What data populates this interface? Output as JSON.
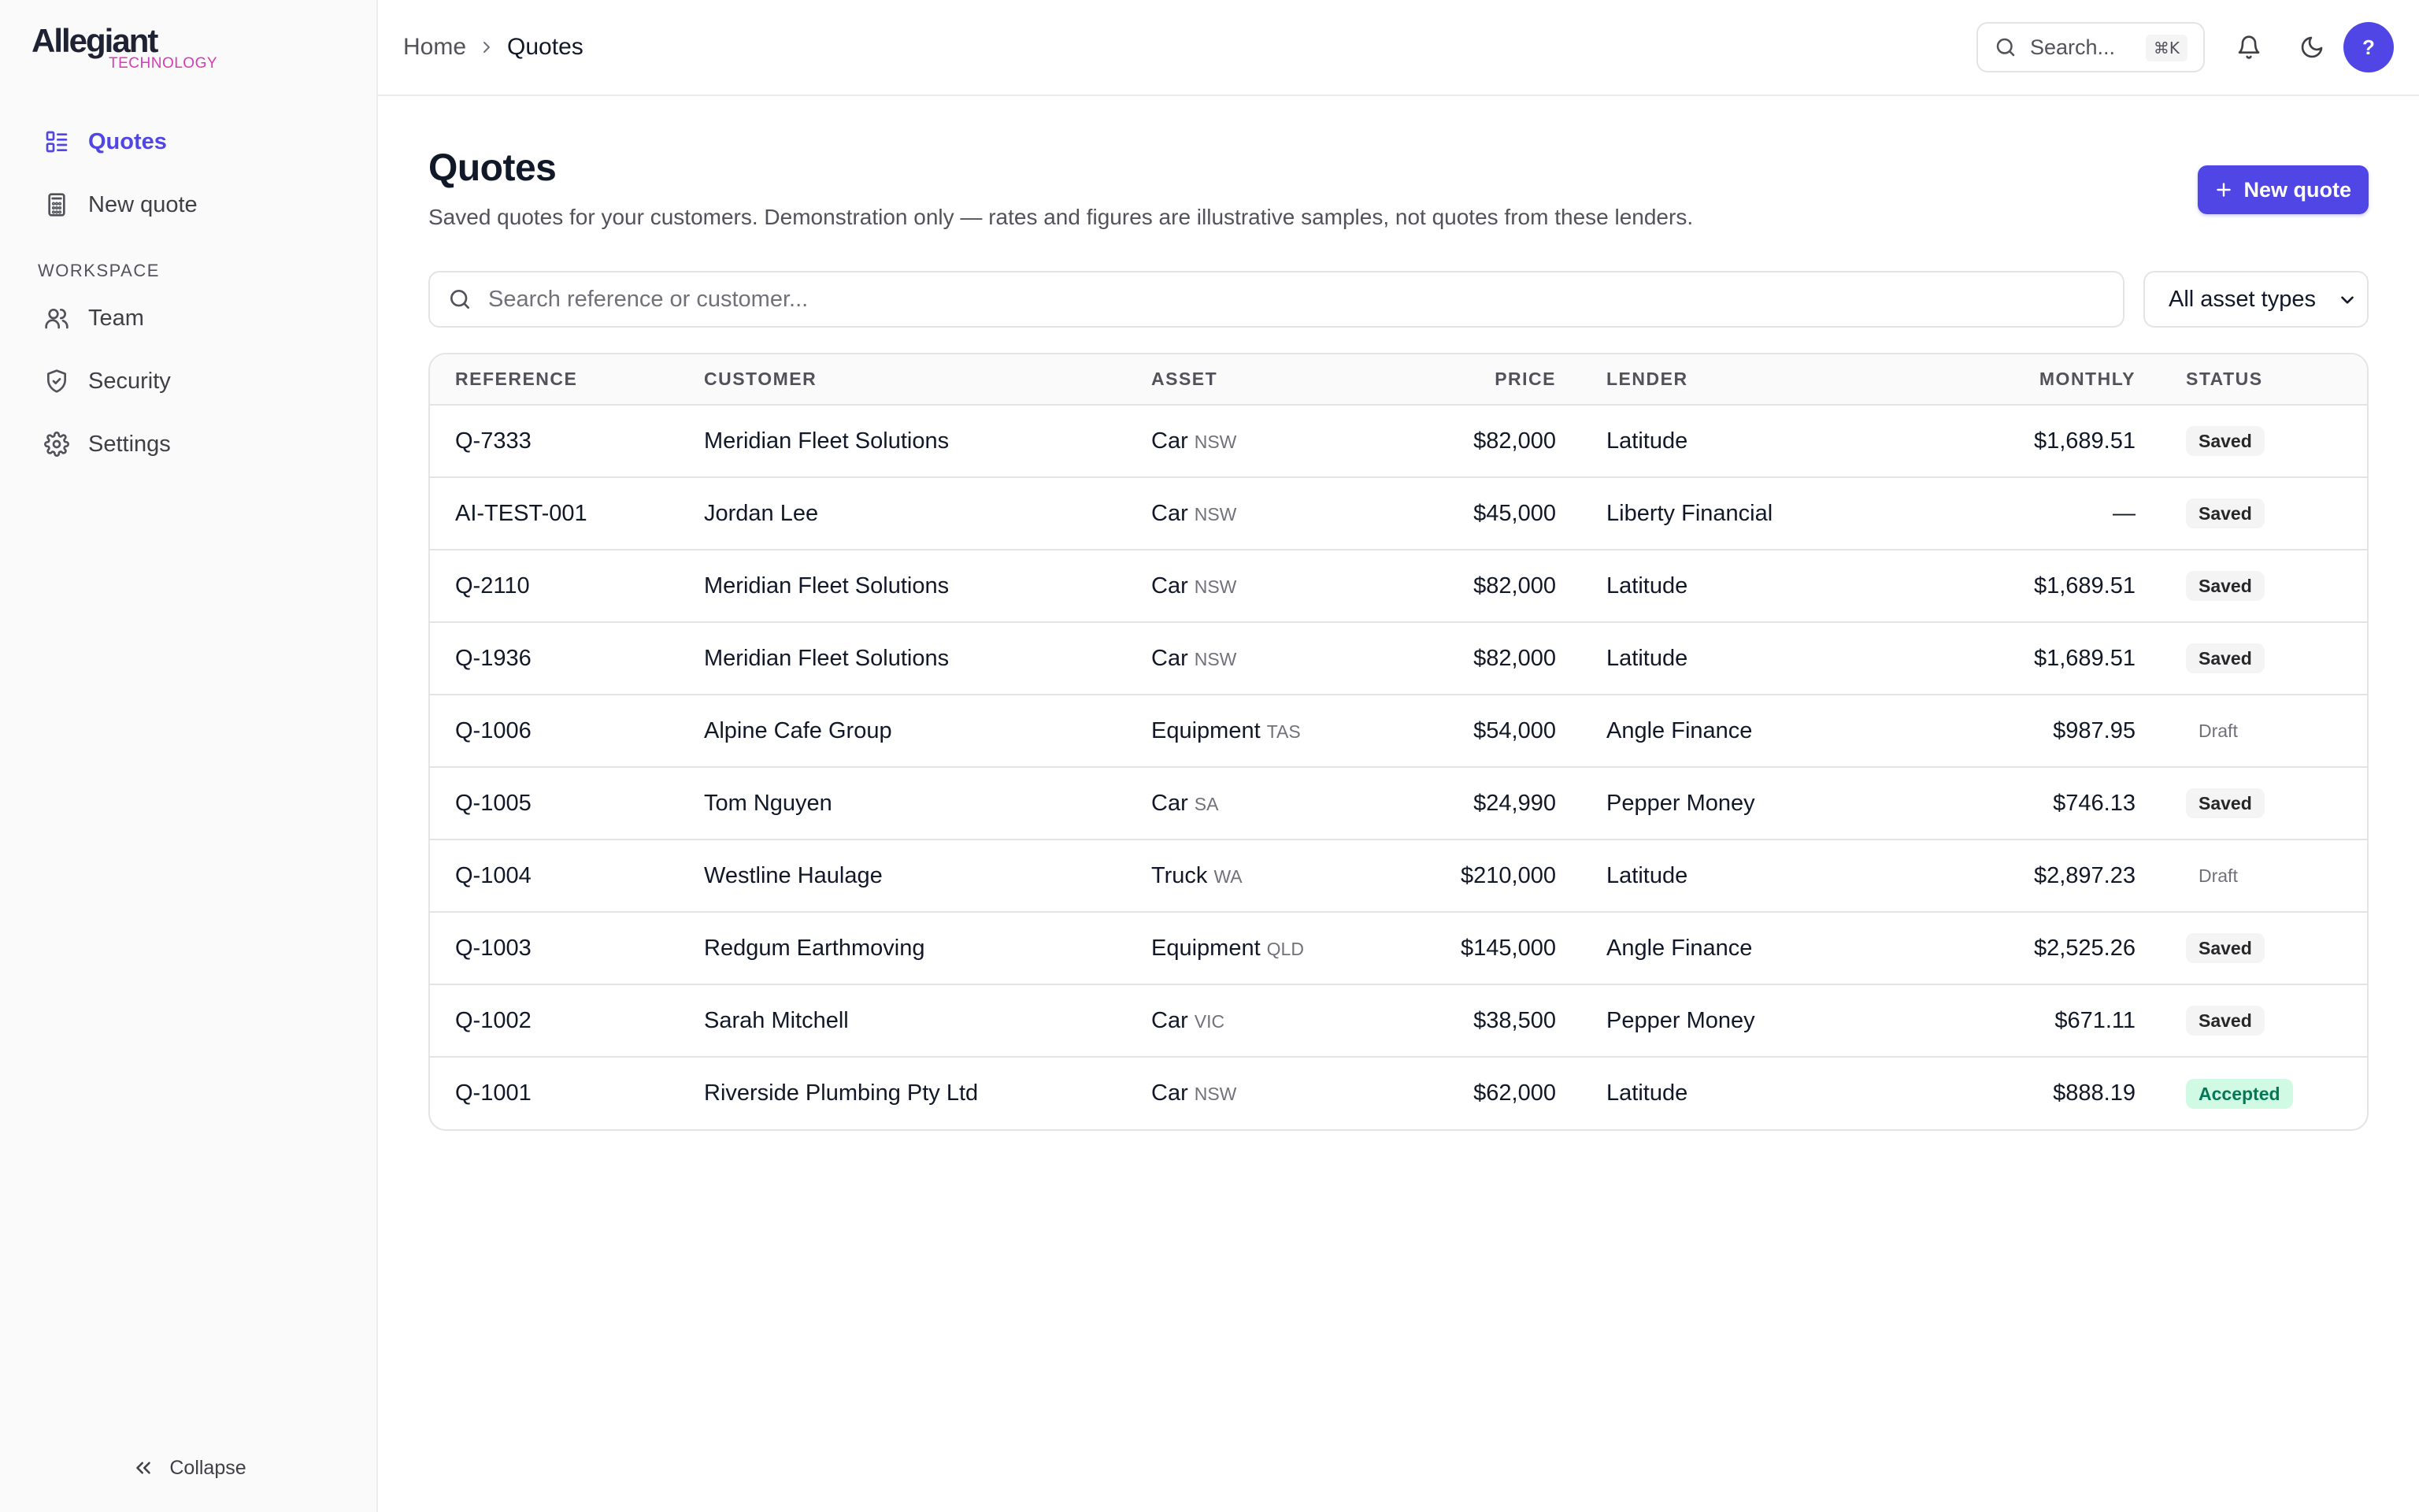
{
  "brand": {
    "name": "Allegiant",
    "sub": "TECHNOLOGY"
  },
  "sidebar": {
    "items": [
      {
        "label": "Quotes",
        "icon": "list-grid-icon",
        "active": true
      },
      {
        "label": "New quote",
        "icon": "calculator-icon"
      }
    ],
    "section_label": "WORKSPACE",
    "workspace_items": [
      {
        "label": "Team",
        "icon": "users-icon"
      },
      {
        "label": "Security",
        "icon": "shield-icon"
      },
      {
        "label": "Settings",
        "icon": "gear-icon"
      }
    ],
    "collapse_label": "Collapse"
  },
  "header": {
    "breadcrumb": {
      "home": "Home",
      "current": "Quotes"
    },
    "search": {
      "placeholder": "Search...",
      "shortcut": "⌘K"
    },
    "avatar_label": "?"
  },
  "page": {
    "title": "Quotes",
    "subtitle": "Saved quotes for your customers. Demonstration only — rates and figures are illustrative samples, not quotes from these lenders.",
    "new_button": "New quote",
    "filter_placeholder": "Search reference or customer...",
    "asset_filter": "All asset types"
  },
  "table": {
    "columns": [
      "REFERENCE",
      "CUSTOMER",
      "ASSET",
      "PRICE",
      "LENDER",
      "MONTHLY",
      "STATUS"
    ],
    "rows": [
      {
        "reference": "Q-7333",
        "customer": "Meridian Fleet Solutions",
        "asset": "Car",
        "state": "NSW",
        "price": "$82,000",
        "lender": "Latitude",
        "monthly": "$1,689.51",
        "status": "Saved"
      },
      {
        "reference": "AI-TEST-001",
        "customer": "Jordan Lee",
        "asset": "Car",
        "state": "NSW",
        "price": "$45,000",
        "lender": "Liberty Financial",
        "monthly": "—",
        "status": "Saved"
      },
      {
        "reference": "Q-2110",
        "customer": "Meridian Fleet Solutions",
        "asset": "Car",
        "state": "NSW",
        "price": "$82,000",
        "lender": "Latitude",
        "monthly": "$1,689.51",
        "status": "Saved"
      },
      {
        "reference": "Q-1936",
        "customer": "Meridian Fleet Solutions",
        "asset": "Car",
        "state": "NSW",
        "price": "$82,000",
        "lender": "Latitude",
        "monthly": "$1,689.51",
        "status": "Saved"
      },
      {
        "reference": "Q-1006",
        "customer": "Alpine Cafe Group",
        "asset": "Equipment",
        "state": "TAS",
        "price": "$54,000",
        "lender": "Angle Finance",
        "monthly": "$987.95",
        "status": "Draft"
      },
      {
        "reference": "Q-1005",
        "customer": "Tom Nguyen",
        "asset": "Car",
        "state": "SA",
        "price": "$24,990",
        "lender": "Pepper Money",
        "monthly": "$746.13",
        "status": "Saved"
      },
      {
        "reference": "Q-1004",
        "customer": "Westline Haulage",
        "asset": "Truck",
        "state": "WA",
        "price": "$210,000",
        "lender": "Latitude",
        "monthly": "$2,897.23",
        "status": "Draft"
      },
      {
        "reference": "Q-1003",
        "customer": "Redgum Earthmoving",
        "asset": "Equipment",
        "state": "QLD",
        "price": "$145,000",
        "lender": "Angle Finance",
        "monthly": "$2,525.26",
        "status": "Saved"
      },
      {
        "reference": "Q-1002",
        "customer": "Sarah Mitchell",
        "asset": "Car",
        "state": "VIC",
        "price": "$38,500",
        "lender": "Pepper Money",
        "monthly": "$671.11",
        "status": "Saved"
      },
      {
        "reference": "Q-1001",
        "customer": "Riverside Plumbing Pty Ltd",
        "asset": "Car",
        "state": "NSW",
        "price": "$62,000",
        "lender": "Latitude",
        "monthly": "$888.19",
        "status": "Accepted"
      }
    ]
  },
  "colors": {
    "accent": "#5046e5",
    "brand_sub": "#d63bb8",
    "accepted_bg": "#d1fae5",
    "accepted_text": "#047857"
  }
}
